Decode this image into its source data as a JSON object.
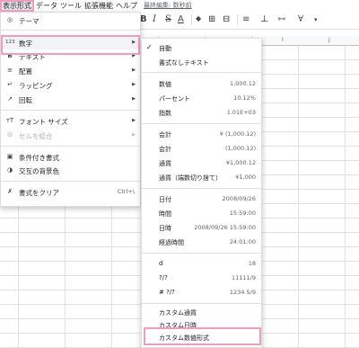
{
  "menubar": {
    "items": [
      "表示形式",
      "データ",
      "ツール",
      "拡張機能",
      "ヘルプ",
      "最終編集: 数秒前"
    ]
  },
  "toolbar": {
    "icons": [
      "bold-icon",
      "italic-icon",
      "strikethrough-icon",
      "text-color-icon",
      "fill-color-icon",
      "borders-icon",
      "merge-icon",
      "align-icon",
      "valign-icon",
      "wrap-icon",
      "rotate-icon"
    ],
    "glyphs": [
      "B",
      "I",
      "S",
      "A",
      "◆",
      "⊞",
      "⊟",
      "≡",
      "⊥",
      "↦",
      "∀"
    ]
  },
  "grid": {
    "columns": [
      "I",
      "J"
    ]
  },
  "format_menu": {
    "theme": {
      "label": "テーマ",
      "icon": "theme-icon"
    },
    "number": {
      "label": "数字",
      "icon": "number-format-icon"
    },
    "text": {
      "label": "テキスト",
      "icon": "bold-icon"
    },
    "alignment": {
      "label": "配置",
      "icon": "align-left-icon"
    },
    "wrapping": {
      "label": "ラッピング",
      "icon": "text-wrap-icon"
    },
    "rotation": {
      "label": "回転",
      "icon": "text-rotate-icon"
    },
    "font_size": {
      "label": "フォント サイズ",
      "icon": "font-size-icon"
    },
    "merge_cells": {
      "label": "セルを結合",
      "icon": "merge-cells-icon"
    },
    "conditional_formatting": {
      "label": "条件付き書式",
      "icon": "conditional-format-icon"
    },
    "alternating_colors": {
      "label": "交互の背景色",
      "icon": "alternating-colors-icon"
    },
    "clear_formatting": {
      "label": "書式をクリア",
      "icon": "clear-format-icon",
      "shortcut": "Ctrl+\\"
    }
  },
  "number_submenu": {
    "automatic": {
      "label": "自動",
      "checked": true
    },
    "plain_text": {
      "label": "書式なしテキスト"
    },
    "number": {
      "label": "数値",
      "example": "1,000.12"
    },
    "percent": {
      "label": "パーセント",
      "example": "10.12%"
    },
    "scientific": {
      "label": "指数",
      "example": "1.01E+03"
    },
    "accounting": {
      "label": "会計",
      "example": "¥ (1,000.12)"
    },
    "financial": {
      "label": "会計",
      "example": "(1,000.12)"
    },
    "currency": {
      "label": "通貨",
      "example": "¥1,000.12"
    },
    "currency_rounded": {
      "label": "通貨（端数切り捨て）",
      "example": "¥1,000"
    },
    "date": {
      "label": "日付",
      "example": "2008/09/26"
    },
    "time": {
      "label": "時間",
      "example": "15:59:00"
    },
    "datetime": {
      "label": "日時",
      "example": "2008/09/26 15:59:00"
    },
    "duration": {
      "label": "経過時間",
      "example": "24:01:00"
    },
    "fraction_d": {
      "label": "d",
      "example": "18"
    },
    "fraction_q": {
      "label": "?/?",
      "example": "11111/9"
    },
    "fraction_mixed": {
      "label": "# ?/?",
      "example": "1234 5/9"
    },
    "custom_currency": {
      "label": "カスタム通貨"
    },
    "custom_datetime": {
      "label": "カスタム日時"
    },
    "custom_number": {
      "label": "カスタム数値形式"
    }
  },
  "colors": {
    "highlight": "#f29bbe",
    "menu_hover": "#e8eaed"
  }
}
